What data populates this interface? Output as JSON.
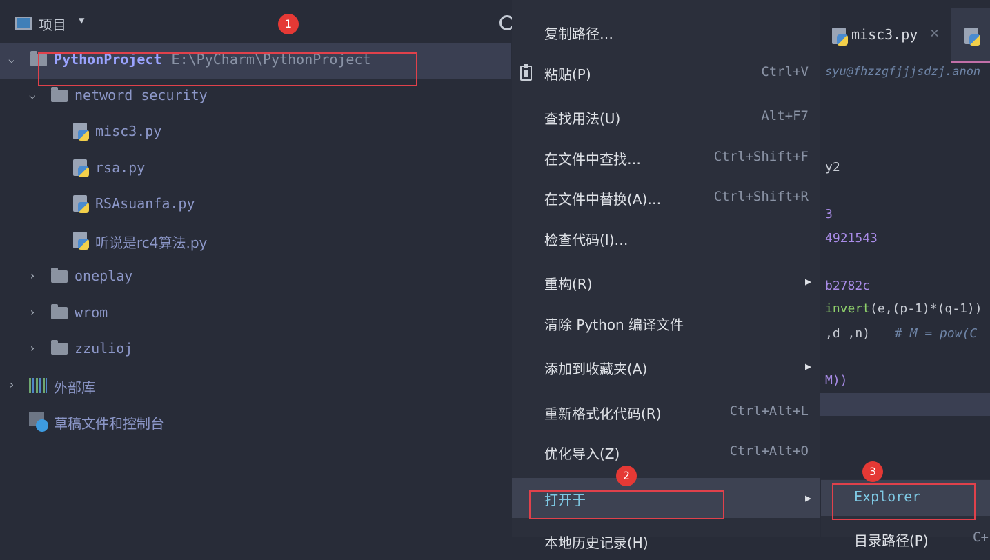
{
  "project_panel": {
    "title": "项目",
    "root": {
      "name": "PythonProject",
      "path": "E:\\PyCharm\\PythonProject"
    },
    "folder_open": "netword security",
    "files": [
      "misc3.py",
      "rsa.py",
      "RSAsuanfa.py",
      "听说是rc4算法.py"
    ],
    "folders_closed": [
      "oneplay",
      "wrom",
      "zzulioj"
    ],
    "external_libs": "外部库",
    "scratches": "草稿文件和控制台"
  },
  "badges": {
    "one": "1",
    "two": "2",
    "three": "3"
  },
  "editor": {
    "tabs": [
      {
        "label": "misc3.py"
      }
    ],
    "author": "syu@fhzzgfjjjsdzj.anon",
    "code": {
      "line1": "y2",
      "line2": "3",
      "line3": "4921543",
      "line4": "b2782c",
      "line5_fn": "invert",
      "line5_rest": "(e,(p-1)*(q-1))",
      "line6": ",d ,n)",
      "line6_comment": "# M = pow(C",
      "line7": "M))"
    }
  },
  "context_menu": {
    "items": [
      {
        "label": "复制路径…",
        "shortcut": ""
      },
      {
        "label": "粘贴(P)",
        "shortcut": "Ctrl+V"
      },
      {
        "label": "查找用法(U)",
        "shortcut": "Alt+F7"
      },
      {
        "label": "在文件中查找…",
        "shortcut": "Ctrl+Shift+F"
      },
      {
        "label": "在文件中替换(A)…",
        "shortcut": "Ctrl+Shift+R"
      },
      {
        "label": "检查代码(I)…",
        "shortcut": ""
      },
      {
        "label": "重构(R)",
        "shortcut": ""
      },
      {
        "label": "清除 Python 编译文件",
        "shortcut": ""
      },
      {
        "label": "添加到收藏夹(A)",
        "shortcut": ""
      },
      {
        "label": "重新格式化代码(R)",
        "shortcut": "Ctrl+Alt+L"
      },
      {
        "label": "优化导入(Z)",
        "shortcut": "Ctrl+Alt+O"
      },
      {
        "label": "打开于",
        "shortcut": ""
      },
      {
        "label": "本地历史记录(H)",
        "shortcut": ""
      }
    ]
  },
  "submenu": {
    "items": [
      {
        "label": "Explorer",
        "shortcut": ""
      },
      {
        "label": "目录路径(P)",
        "shortcut": "C+"
      }
    ]
  }
}
